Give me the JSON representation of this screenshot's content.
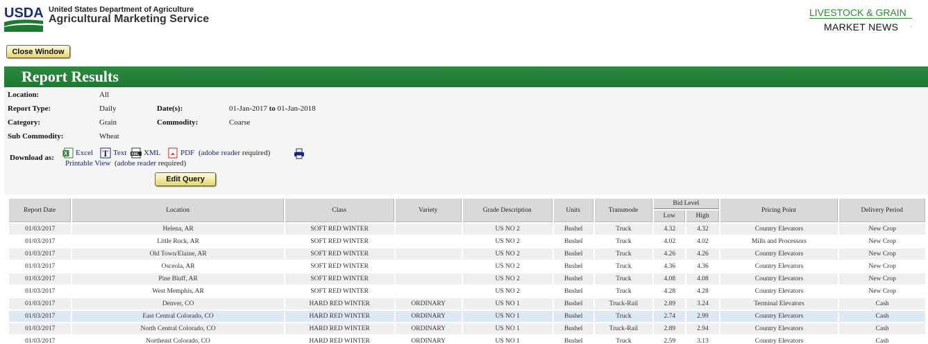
{
  "header": {
    "logo_text": "USDA",
    "dept": "United States Department of Agriculture",
    "agency": "Agricultural Marketing Service",
    "right_title_1": "LIVESTOCK & GRAIN",
    "right_title_2": "MARKET NEWS"
  },
  "buttons": {
    "close_window": "Close Window",
    "edit_query": "Edit Query"
  },
  "results_title": "Report Results",
  "info": {
    "location_label": "Location:",
    "location_value": "All",
    "report_type_label": "Report Type:",
    "report_type_value": "Daily",
    "dates_label": "Date(s):",
    "date_from": "01-Jan-2017",
    "date_to_word": "to",
    "date_to": "01-Jan-2018",
    "category_label": "Category:",
    "category_value": "Grain",
    "commodity_label": "Commodity:",
    "commodity_value": "Coarse",
    "sub_commodity_label": "Sub Commodity:",
    "sub_commodity_value": "Wheat"
  },
  "download": {
    "label": "Download as:",
    "excel": "Excel",
    "text": "Text",
    "xml": "XML",
    "pdf": "PDF",
    "adobe_link": "adobe reader",
    "required": "required)",
    "printable_view": "Printable View",
    "icons": [
      "excel-icon",
      "text-icon",
      "xml-icon",
      "pdf-icon",
      "printer-icon"
    ]
  },
  "table": {
    "headers": {
      "report_date": "Report Date",
      "location": "Location",
      "class": "Class",
      "variety": "Variety",
      "grade": "Grade Description",
      "units": "Units",
      "transmode": "Transmode",
      "bid_level": "Bid Level",
      "low": "Low",
      "high": "High",
      "pricing_point": "Pricing Point",
      "delivery_period": "Delivery Period"
    },
    "rows": [
      [
        "01/03/2017",
        "Helena, AR",
        "SOFT RED WINTER",
        "",
        "US NO 2",
        "Bushel",
        "Truck",
        "4.32",
        "4.32",
        "Country Elevators",
        "New Crop"
      ],
      [
        "01/03/2017",
        "Little Rock, AR",
        "SOFT RED WINTER",
        "",
        "US NO 2",
        "Bushel",
        "Truck",
        "4.02",
        "4.02",
        "Mills and Processors",
        "New Crop"
      ],
      [
        "01/03/2017",
        "Old Town/Elaine, AR",
        "SOFT RED WINTER",
        "",
        "US NO 2",
        "Bushel",
        "Truck",
        "4.26",
        "4.26",
        "Country Elevators",
        "New Crop"
      ],
      [
        "01/03/2017",
        "Osceola, AR",
        "SOFT RED WINTER",
        "",
        "US NO 2",
        "Bushel",
        "Truck",
        "4.36",
        "4.36",
        "Country Elevators",
        "New Crop"
      ],
      [
        "01/03/2017",
        "Pine Bluff, AR",
        "SOFT RED WINTER",
        "",
        "US NO 2",
        "Bushel",
        "Truck",
        "4.08",
        "4.08",
        "Country Elevators",
        "New Crop"
      ],
      [
        "01/03/2017",
        "West Memphis, AR",
        "SOFT RED WINTER",
        "",
        "US NO 2",
        "Bushel",
        "Truck",
        "4.28",
        "4.28",
        "Country Elevators",
        "New Crop"
      ],
      [
        "01/03/2017",
        "Denver, CO",
        "HARD RED WINTER",
        "ORDINARY",
        "US NO 1",
        "Bushel",
        "Truck-Rail",
        "2.89",
        "3.24",
        "Terminal Elevators",
        "Cash"
      ],
      [
        "01/03/2017",
        "East Central Colorado, CO",
        "HARD RED WINTER",
        "ORDINARY",
        "US NO 1",
        "Bushel",
        "Truck",
        "2.74",
        "2.99",
        "Country Elevators",
        "Cash"
      ],
      [
        "01/03/2017",
        "North Central Colorado, CO",
        "HARD RED WINTER",
        "ORDINARY",
        "US NO 1",
        "Bushel",
        "Truck-Rail",
        "2.89",
        "2.94",
        "Country Elevators",
        "Cash"
      ],
      [
        "01/03/2017",
        "Northeast Colorado, CO",
        "HARD RED WINTER",
        "ORDINARY",
        "US NO 1",
        "Bushel",
        "Truck",
        "2.59",
        "3.13",
        "Country Elevators",
        "Cash"
      ]
    ],
    "highlighted_row": 7
  },
  "colors": {
    "usda_green": "#1d7a32",
    "usda_blue": "#1a2f6e",
    "link_blue": "#1a237e",
    "row_highlight": "#dde9f5"
  }
}
